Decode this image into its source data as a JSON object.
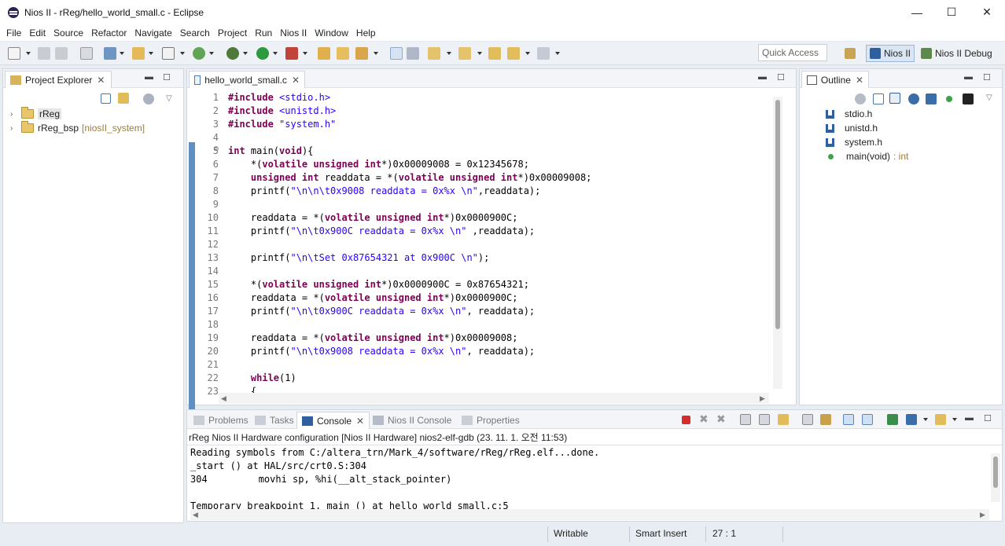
{
  "window": {
    "title": "Nios II - rReg/hello_world_small.c - Eclipse",
    "minimize": "—",
    "maximize": "☐",
    "close": "✕"
  },
  "menu": [
    "File",
    "Edit",
    "Source",
    "Refactor",
    "Navigate",
    "Search",
    "Project",
    "Run",
    "Nios II",
    "Window",
    "Help"
  ],
  "toolbar": {
    "quick_access_placeholder": "Quick Access",
    "perspectives": [
      "Nios II",
      "Nios II Debug"
    ]
  },
  "project_explorer": {
    "tab_label": "Project Explorer",
    "items": [
      {
        "label": "rReg",
        "decoration": ""
      },
      {
        "label": "rReg_bsp",
        "decoration": "[niosII_system]"
      }
    ]
  },
  "editor": {
    "tab_label": "hello_world_small.c",
    "lines": [
      {
        "n": "1",
        "html": "<span class=\"kw\">#include</span> <span class=\"inc\">&lt;stdio.h&gt;</span>"
      },
      {
        "n": "2",
        "html": "<span class=\"kw\">#include</span> <span class=\"inc\">&lt;unistd.h&gt;</span>"
      },
      {
        "n": "3",
        "html": "<span class=\"kw\">#include</span> <span class=\"inc\">\"system.h\"</span>"
      },
      {
        "n": "4",
        "html": ""
      },
      {
        "n": "5",
        "html": "<span class=\"kw\">int</span> main(<span class=\"kw\">void</span>){"
      },
      {
        "n": "6",
        "html": "    *(<span class=\"kw\">volatile unsigned int</span>*)0x00009008 = 0x12345678;"
      },
      {
        "n": "7",
        "html": "    <span class=\"kw\">unsigned int</span> readdata = *(<span class=\"kw\">volatile unsigned int</span>*)0x00009008;"
      },
      {
        "n": "8",
        "html": "    printf(<span class=\"str\">\"\\n\\n\\t0x9008 readdata = 0x%x \\n\"</span>,readdata);"
      },
      {
        "n": "9",
        "html": ""
      },
      {
        "n": "10",
        "html": "    readdata = *(<span class=\"kw\">volatile unsigned int</span>*)0x0000900C;"
      },
      {
        "n": "11",
        "html": "    printf(<span class=\"str\">\"\\n\\t0x900C readdata = 0x%x \\n\"</span> ,readdata);"
      },
      {
        "n": "12",
        "html": ""
      },
      {
        "n": "13",
        "html": "    printf(<span class=\"str\">\"\\n\\tSet 0x87654321 at 0x900C \\n\"</span>);"
      },
      {
        "n": "14",
        "html": ""
      },
      {
        "n": "15",
        "html": "    *(<span class=\"kw\">volatile unsigned int</span>*)0x0000900C = 0x87654321;"
      },
      {
        "n": "16",
        "html": "    readdata = *(<span class=\"kw\">volatile unsigned int</span>*)0x0000900C;"
      },
      {
        "n": "17",
        "html": "    printf(<span class=\"str\">\"\\n\\t0x900C readdata = 0x%x \\n\"</span>, readdata);"
      },
      {
        "n": "18",
        "html": ""
      },
      {
        "n": "19",
        "html": "    readdata = *(<span class=\"kw\">volatile unsigned int</span>*)0x00009008;"
      },
      {
        "n": "20",
        "html": "    printf(<span class=\"str\">\"\\n\\t0x9008 readdata = 0x%x \\n\"</span>, readdata);"
      },
      {
        "n": "21",
        "html": ""
      },
      {
        "n": "22",
        "html": "    <span class=\"kw\">while</span>(1)"
      },
      {
        "n": "23",
        "html": "    {"
      }
    ]
  },
  "outline": {
    "tab_label": "Outline",
    "items": [
      {
        "label": "stdio.h",
        "type": ""
      },
      {
        "label": "unistd.h",
        "type": ""
      },
      {
        "label": "system.h",
        "type": ""
      },
      {
        "label": "main(void)",
        "type": ": int"
      }
    ]
  },
  "bottom_tabs": [
    "Problems",
    "Tasks",
    "Console",
    "Nios II Console",
    "Properties"
  ],
  "console": {
    "description": "rReg Nios II Hardware configuration [Nios II Hardware] nios2-elf-gdb (23. 11. 1. 오전 11:53)",
    "lines": [
      "Reading symbols from C:/altera_trn/Mark_4/software/rReg/rReg.elf...done.",
      "_start () at HAL/src/crt0.S:304",
      "304         movhi sp, %hi(__alt_stack_pointer)",
      "",
      "Temporary breakpoint 1, main () at hello_world_small.c:5"
    ]
  },
  "status": {
    "writable": "Writable",
    "insert_mode": "Smart Insert",
    "position": "27 : 1"
  }
}
